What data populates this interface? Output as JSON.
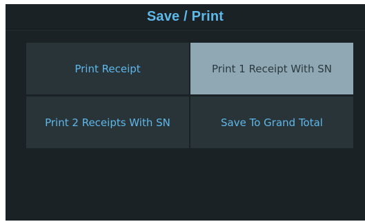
{
  "dialog": {
    "title": "Save / Print",
    "options": [
      {
        "label": "Print Receipt",
        "selected": false
      },
      {
        "label": "Print 1 Receipt With SN",
        "selected": true
      },
      {
        "label": "Print 2 Receipts With SN",
        "selected": false
      },
      {
        "label": "Save To Grand Total",
        "selected": false
      }
    ]
  },
  "colors": {
    "background": "#1a2226",
    "button": "#283438",
    "button_selected": "#8fa8b3",
    "accent_text": "#5fb8ea",
    "selected_text": "#2b3a40"
  }
}
